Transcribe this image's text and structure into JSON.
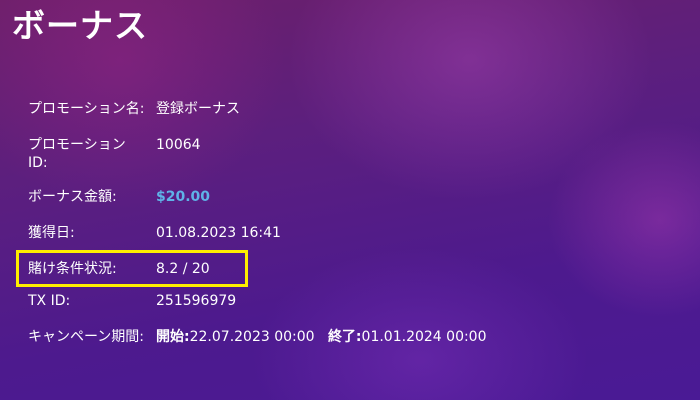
{
  "page": {
    "title": "ボーナス"
  },
  "info": {
    "promotion_name_label": "プロモーション名:",
    "promotion_name_value": "登録ボーナス",
    "promotion_id_label": "プロモーションID:",
    "promotion_id_value": "10064",
    "bonus_amount_label": "ボーナス金額:",
    "bonus_amount_value": "$20.00",
    "acquired_date_label": "獲得日:",
    "acquired_date_value": "01.08.2023 16:41",
    "wager_status_label": "賭け条件状況:",
    "wager_status_value": "8.2 / 20",
    "tx_id_label": "TX ID:",
    "tx_id_value": "251596979",
    "campaign_period_label": "キャンペーン期間:",
    "campaign_start_label": "開始:",
    "campaign_start_value": "22.07.2023 00:00",
    "campaign_end_label": "終了:",
    "campaign_end_value": "01.01.2024 00:00"
  },
  "colors": {
    "money": "#5fb3e8",
    "highlight": "#ffee00"
  }
}
